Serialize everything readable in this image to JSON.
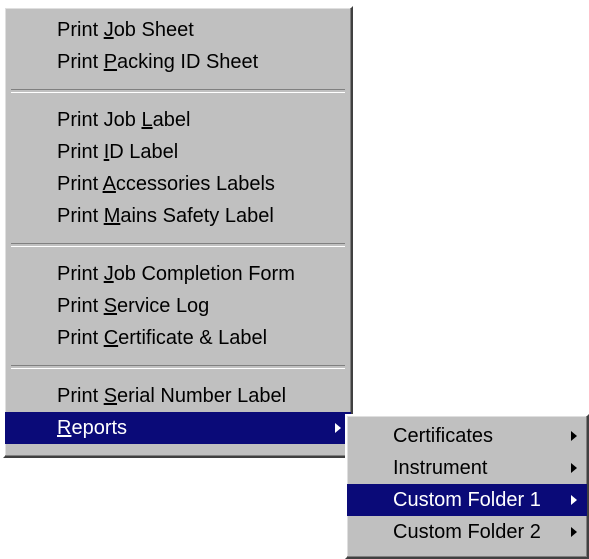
{
  "main_menu": {
    "group1": [
      {
        "prefix": "Print ",
        "accel": "J",
        "suffix": "ob Sheet"
      },
      {
        "prefix": "Print ",
        "accel": "P",
        "suffix": "acking ID Sheet"
      }
    ],
    "group2": [
      {
        "prefix": "Print Job ",
        "accel": "L",
        "suffix": "abel"
      },
      {
        "prefix": "Print ",
        "accel": "I",
        "suffix": "D Label"
      },
      {
        "prefix": "Print ",
        "accel": "A",
        "suffix": "ccessories Labels"
      },
      {
        "prefix": "Print ",
        "accel": "M",
        "suffix": "ains Safety Label"
      }
    ],
    "group3": [
      {
        "prefix": "Print ",
        "accel": "J",
        "suffix": "ob Completion Form"
      },
      {
        "prefix": "Print ",
        "accel": "S",
        "suffix": "ervice Log"
      },
      {
        "prefix": "Print ",
        "accel": "C",
        "suffix": "ertificate & Label"
      }
    ],
    "group4": [
      {
        "prefix": "Print ",
        "accel": "S",
        "suffix": "erial Number Label"
      },
      {
        "prefix": "",
        "accel": "R",
        "suffix": "eports"
      }
    ]
  },
  "sub_menu": {
    "items": [
      {
        "label": "Certificates"
      },
      {
        "label": "Instrument"
      },
      {
        "label": "Custom Folder 1"
      },
      {
        "label": "Custom Folder 2"
      }
    ]
  },
  "colors": {
    "menu_bg": "#c0c0c0",
    "highlight": "#0a0a78"
  },
  "icons": {
    "submenu_arrow": "triangle-right-icon"
  }
}
